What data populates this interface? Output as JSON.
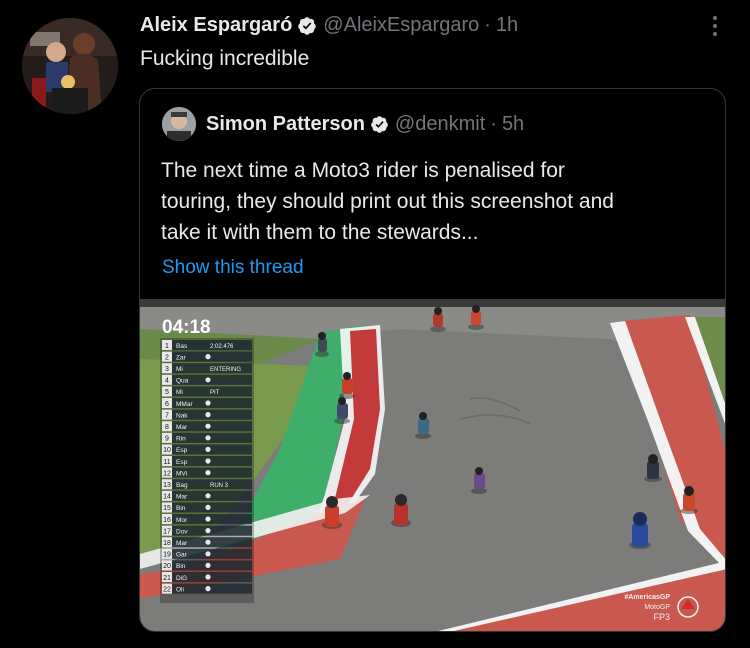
{
  "tweet": {
    "author_name": "Aleix Espargaró",
    "handle": "@AleixEspargaro",
    "separator": "·",
    "time": "1h",
    "text": "Fucking incredible",
    "verified_color": "#e7e9ea"
  },
  "quoted": {
    "author_name": "Simon Patterson",
    "handle": "@denkmit",
    "separator": "·",
    "time": "5h",
    "text": "The next time a Moto3 rider is penalised for\ntouring, they should print out this screenshot and\ntake it with them to the stewards...",
    "show_thread": "Show this thread",
    "link_color": "#1d9bf0"
  },
  "media": {
    "timer": "04:18",
    "standings": [
      {
        "pos": "1",
        "rider": "Bas",
        "status": "2:02.476"
      },
      {
        "pos": "2",
        "rider": "Zar",
        "status": ""
      },
      {
        "pos": "3",
        "rider": "Mi",
        "status": "ENTERING"
      },
      {
        "pos": "4",
        "rider": "Qua",
        "status": ""
      },
      {
        "pos": "5",
        "rider": "Mi",
        "status": "PIT"
      },
      {
        "pos": "6",
        "rider": "MMar",
        "status": ""
      },
      {
        "pos": "7",
        "rider": "Nak",
        "status": ""
      },
      {
        "pos": "8",
        "rider": "Mar",
        "status": ""
      },
      {
        "pos": "9",
        "rider": "Rin",
        "status": ""
      },
      {
        "pos": "10",
        "rider": "Esp",
        "status": ""
      },
      {
        "pos": "11",
        "rider": "Esp",
        "status": ""
      },
      {
        "pos": "12",
        "rider": "MVi",
        "status": ""
      },
      {
        "pos": "13",
        "rider": "Bag",
        "status": "RUN 3"
      },
      {
        "pos": "14",
        "rider": "Mar",
        "status": ""
      },
      {
        "pos": "15",
        "rider": "Bin",
        "status": ""
      },
      {
        "pos": "16",
        "rider": "Mor",
        "status": ""
      },
      {
        "pos": "17",
        "rider": "Dov",
        "status": ""
      },
      {
        "pos": "18",
        "rider": "Mar",
        "status": ""
      },
      {
        "pos": "19",
        "rider": "Gar",
        "status": ""
      },
      {
        "pos": "20",
        "rider": "Bin",
        "status": ""
      },
      {
        "pos": "21",
        "rider": "DiG",
        "status": ""
      },
      {
        "pos": "22",
        "rider": "Oli",
        "status": ""
      }
    ],
    "logo_lines": [
      "#AmericasGP",
      "MotoGP",
      "FP3"
    ]
  }
}
